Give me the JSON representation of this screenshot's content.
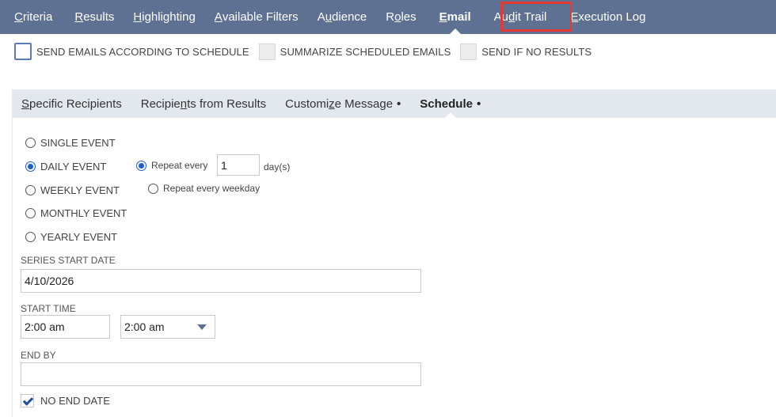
{
  "top_tabs": [
    {
      "pre": "",
      "ul": "C",
      "post": "riteria"
    },
    {
      "pre": "",
      "ul": "R",
      "post": "esults"
    },
    {
      "pre": "",
      "ul": "H",
      "post": "ighlighting"
    },
    {
      "pre": "",
      "ul": "A",
      "post": "vailable Filters"
    },
    {
      "pre": "A",
      "ul": "u",
      "post": "dience"
    },
    {
      "pre": "R",
      "ul": "o",
      "post": "les"
    },
    {
      "pre": "",
      "ul": "E",
      "post": "mail"
    },
    {
      "pre": "Au",
      "ul": "d",
      "post": "it Trail"
    },
    {
      "pre": "",
      "ul": "E",
      "post": "xecution Log"
    }
  ],
  "email_options": {
    "send_according": "SEND EMAILS ACCORDING TO SCHEDULE",
    "summarize": "SUMMARIZE SCHEDULED EMAILS",
    "send_if_no_results": "SEND IF NO RESULTS"
  },
  "sub_tabs": [
    {
      "pre": "",
      "ul": "S",
      "post": "pecific Recipients"
    },
    {
      "pre": "Recipie",
      "ul": "n",
      "post": "ts from Results"
    },
    {
      "pre": "Customi",
      "ul": "z",
      "post": "e Message"
    },
    {
      "pre": "",
      "ul": "",
      "post": "Schedule"
    }
  ],
  "sub_tab_dot": "•",
  "schedule": {
    "single": "SINGLE EVENT",
    "daily": "DAILY EVENT",
    "weekly": "WEEKLY EVENT",
    "monthly": "MONTHLY EVENT",
    "yearly": "YEARLY EVENT",
    "repeat_every": "Repeat every",
    "repeat_value": "1",
    "days_unit": "day(s)",
    "repeat_weekday": "Repeat every weekday",
    "series_start_label": "SERIES START DATE",
    "series_start_value": "4/10/2026",
    "start_time_label": "START TIME",
    "start_time_value": "2:00 am",
    "start_time_select": "2:00 am",
    "end_by_label": "END BY",
    "end_by_value": "",
    "no_end_date": "NO END DATE"
  }
}
